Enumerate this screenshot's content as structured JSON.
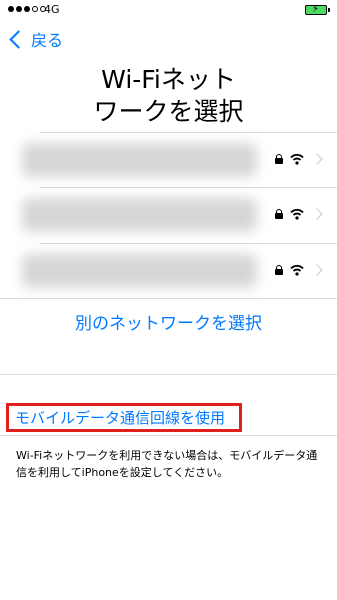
{
  "status_bar": {
    "carrier": "4G",
    "signal_bars": 5,
    "signal_filled": 3,
    "battery_charging": true,
    "battery_color": "#4cd964"
  },
  "nav": {
    "back_label": "戻る",
    "back_icon": "chevron-left-icon"
  },
  "title": {
    "line1": "Wi-Fiネット",
    "line2": "ワークを選択"
  },
  "networks": [
    {
      "secured": true,
      "lock_icon": "lock-icon",
      "signal_icon": "wifi-icon",
      "detail_icon": "chevron-right-icon"
    },
    {
      "secured": true,
      "lock_icon": "lock-icon",
      "signal_icon": "wifi-icon",
      "detail_icon": "chevron-right-icon"
    },
    {
      "secured": true,
      "lock_icon": "lock-icon",
      "signal_icon": "wifi-icon",
      "detail_icon": "chevron-right-icon"
    }
  ],
  "other_network_label": "別のネットワークを選択",
  "cellular_button_label": "モバイルデータ通信回線を使用",
  "footer_note": "Wi-Fiネットワークを利用できない場合は、モバイルデータ通信を利用してiPhoneを設定してください。",
  "colors": {
    "accent": "#007aff",
    "highlight": "#e0201c"
  }
}
